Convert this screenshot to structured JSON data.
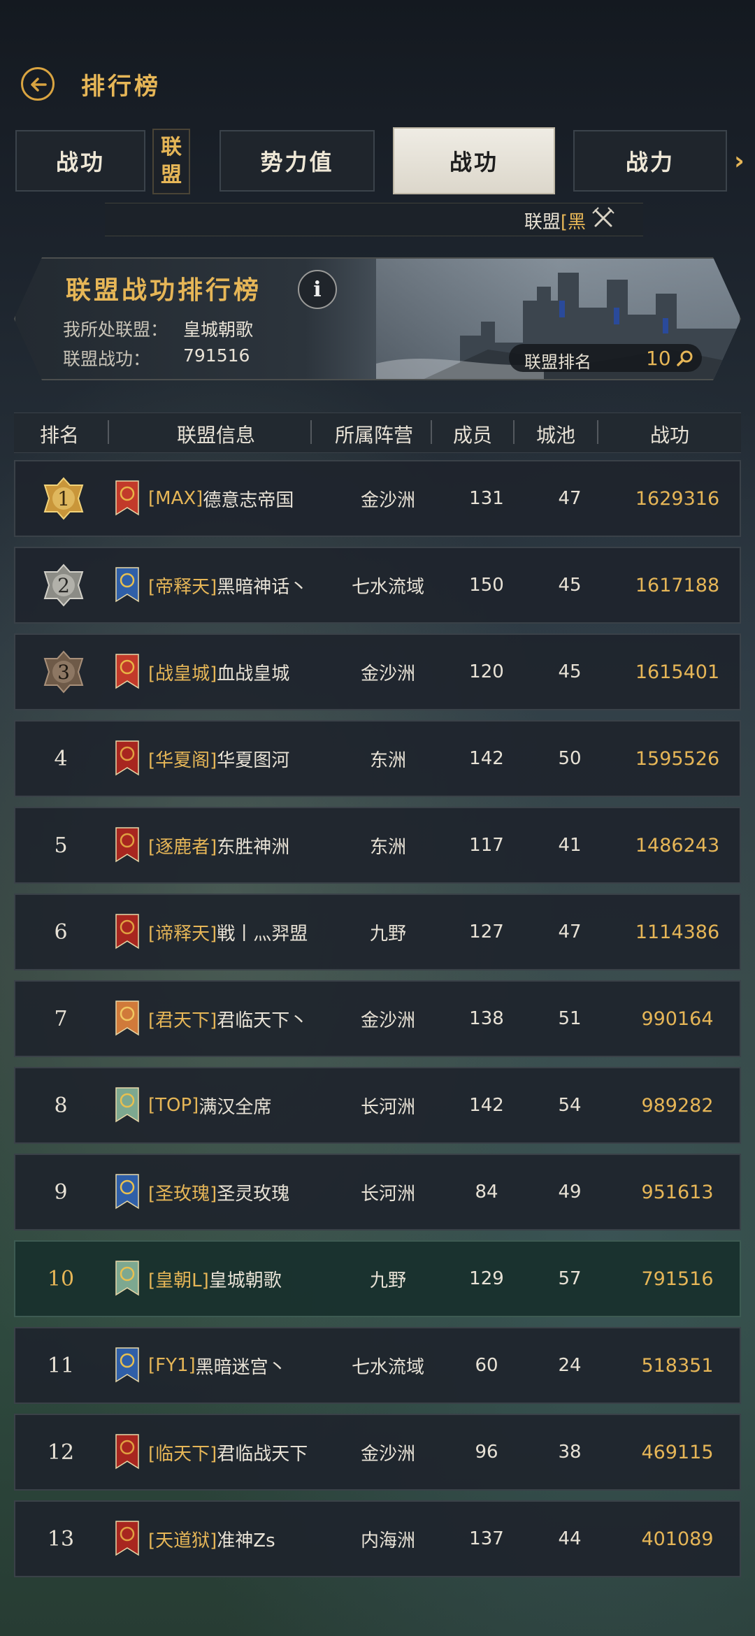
{
  "header": {
    "title": "排行榜"
  },
  "tabs": [
    {
      "label": "战功",
      "active": false
    },
    {
      "label": "势力值",
      "active": false
    },
    {
      "label": "战功",
      "active": true
    },
    {
      "label": "战力",
      "active": false
    }
  ],
  "category": {
    "line1": "联",
    "line2": "盟"
  },
  "filter": {
    "label": "联盟",
    "tag": "[黑"
  },
  "banner": {
    "title": "联盟战功排行榜",
    "my_alliance_label": "我所处联盟：",
    "my_alliance_value": "皇城朝歌",
    "merit_label": "联盟战功：",
    "merit_value": "791516",
    "rank_label": "联盟排名",
    "rank_value": "10"
  },
  "table": {
    "headers": [
      "排名",
      "联盟信息",
      "所属阵营",
      "成员",
      "城池",
      "战功"
    ],
    "rows": [
      {
        "rank": "1",
        "tag": "[MAX]",
        "name": "德意志帝国",
        "camp": "金沙洲",
        "members": "131",
        "cities": "47",
        "merit": "1629316",
        "flag": "red-laurel",
        "medal": "gold"
      },
      {
        "rank": "2",
        "tag": "[帝释天]",
        "name": "黑暗神话丶",
        "camp": "七水流域",
        "members": "150",
        "cities": "45",
        "merit": "1617188",
        "flag": "blue-lion",
        "medal": "silver"
      },
      {
        "rank": "3",
        "tag": "[战皇城]",
        "name": "血战皇城",
        "camp": "金沙洲",
        "members": "120",
        "cities": "45",
        "merit": "1615401",
        "flag": "red-laurel",
        "medal": "bronze"
      },
      {
        "rank": "4",
        "tag": "[华夏阁]",
        "name": "华夏图河",
        "camp": "东洲",
        "members": "142",
        "cities": "50",
        "merit": "1595526",
        "flag": "red-dragon",
        "medal": ""
      },
      {
        "rank": "5",
        "tag": "[逐鹿者]",
        "name": "东胜神洲",
        "camp": "东洲",
        "members": "117",
        "cities": "41",
        "merit": "1486243",
        "flag": "red-dragon",
        "medal": ""
      },
      {
        "rank": "6",
        "tag": "[谛释天]",
        "name": "戦丨灬羿盟",
        "camp": "九野",
        "members": "127",
        "cities": "47",
        "merit": "1114386",
        "flag": "red-dragon",
        "medal": ""
      },
      {
        "rank": "7",
        "tag": "[君天下]",
        "name": "君临天下丶",
        "camp": "金沙洲",
        "members": "138",
        "cities": "51",
        "merit": "990164",
        "flag": "orange-eagle",
        "medal": ""
      },
      {
        "rank": "8",
        "tag": "[TOP]",
        "name": "满汉全席",
        "camp": "长河洲",
        "members": "142",
        "cities": "54",
        "merit": "989282",
        "flag": "green-lion",
        "medal": ""
      },
      {
        "rank": "9",
        "tag": "[圣玫瑰]",
        "name": "圣灵玫瑰",
        "camp": "长河洲",
        "members": "84",
        "cities": "49",
        "merit": "951613",
        "flag": "blue-lion",
        "medal": ""
      },
      {
        "rank": "10",
        "tag": "[皇朝L]",
        "name": "皇城朝歌",
        "camp": "九野",
        "members": "129",
        "cities": "57",
        "merit": "791516",
        "flag": "green-lion",
        "medal": "",
        "mine": true
      },
      {
        "rank": "11",
        "tag": "[FY1]",
        "name": "黑暗迷宫丶",
        "camp": "七水流域",
        "members": "60",
        "cities": "24",
        "merit": "518351",
        "flag": "blue-lion",
        "medal": ""
      },
      {
        "rank": "12",
        "tag": "[临天下]",
        "name": "君临战天下",
        "camp": "金沙洲",
        "members": "96",
        "cities": "38",
        "merit": "469115",
        "flag": "red-dragon",
        "medal": ""
      },
      {
        "rank": "13",
        "tag": "[天道狱]",
        "name": "准神Zs",
        "camp": "内海洲",
        "members": "137",
        "cities": "44",
        "merit": "401089",
        "flag": "red-dragon",
        "medal": ""
      }
    ]
  },
  "colors": {
    "gold": "#e6b657",
    "text": "#e8e2d6",
    "row": "#1e242c",
    "mine_row": "#18302c"
  }
}
